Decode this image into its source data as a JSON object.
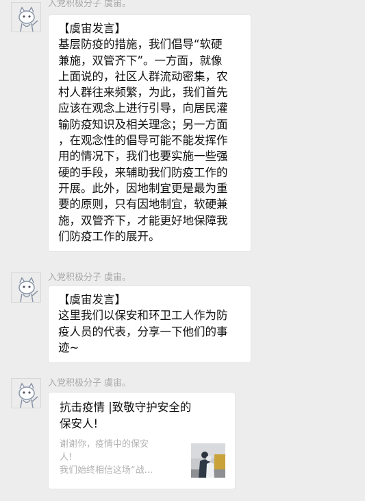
{
  "messages": [
    {
      "sender": "入党积极分子 虞宙。",
      "lines": [
        "【虞宙发言】",
        "基层防疫的措施，我们倡导“软硬",
        "兼施，双管齐下”。一方面，就像",
        "上面说的，社区人群流动密集，农",
        "村人群往来频繁，为此，我们首先",
        "应该在观念上进行引导，向居民灌",
        "输防疫知识及相关理念；另一方面",
        "，在观念性的倡导可能不能发挥作",
        "用的情况下，我们也要实施一些强",
        "硬的手段，来辅助我们防疫工作的",
        "开展。此外，因地制宜更是最为重",
        "要的原则，只有因地制宜，软硬兼",
        "施，双管齐下，才能更好地保障我",
        "们防疫工作的展开。"
      ]
    },
    {
      "sender": "入党积极分子 虞宙。",
      "lines": [
        "【虞宙发言】",
        "这里我们以保安和环卫工人作为防",
        "疫人员的代表，分享一下他们的事",
        "迹~"
      ]
    },
    {
      "sender": "入党积极分子 虞宙。",
      "card": {
        "title_lines": [
          "抗击疫情 |致敬守护安全的",
          "保安人!"
        ],
        "desc_lines": [
          "谢谢你，疫情中的保安",
          "人!",
          "我们始终相信这场“战..."
        ]
      }
    }
  ]
}
